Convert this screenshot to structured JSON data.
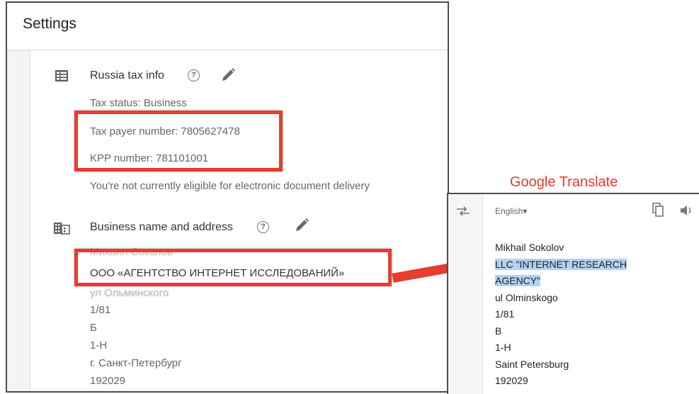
{
  "settings": {
    "title": "Settings",
    "tax_section": {
      "title": "Russia tax info",
      "help_glyph": "?",
      "tax_status": "Tax status: Business",
      "tax_payer_number": "Tax payer number: 7805627478",
      "kpp_number": "KPP number: 781101001",
      "eligibility_note": "You're not currently eligible for electronic document delivery"
    },
    "business_section": {
      "title": "Business name and address",
      "help_glyph": "?",
      "lines": [
        "Михаил Соколов",
        "ООО «АГЕНТСТВО ИНТЕРНЕТ ИССЛЕДОВАНИЙ»",
        "ул Ольминского",
        "1/81",
        "Б",
        "1-Н",
        "г. Санкт-Петербург",
        "192029"
      ]
    }
  },
  "annotation": {
    "label": "Google Translate",
    "color": "#e53d2f"
  },
  "translate": {
    "language": "English▾",
    "lines": {
      "name": "Mikhail Sokolov",
      "company_line1": "LLC \"INTERNET RESEARCH",
      "company_line2": "AGENCY\"",
      "street": "ul Olminskogo",
      "building": "1/81",
      "letter": "B",
      "unit": "1-H",
      "city": "Saint Petersburg",
      "postal": "192029"
    },
    "highlight_color": "#b3d2f3"
  }
}
